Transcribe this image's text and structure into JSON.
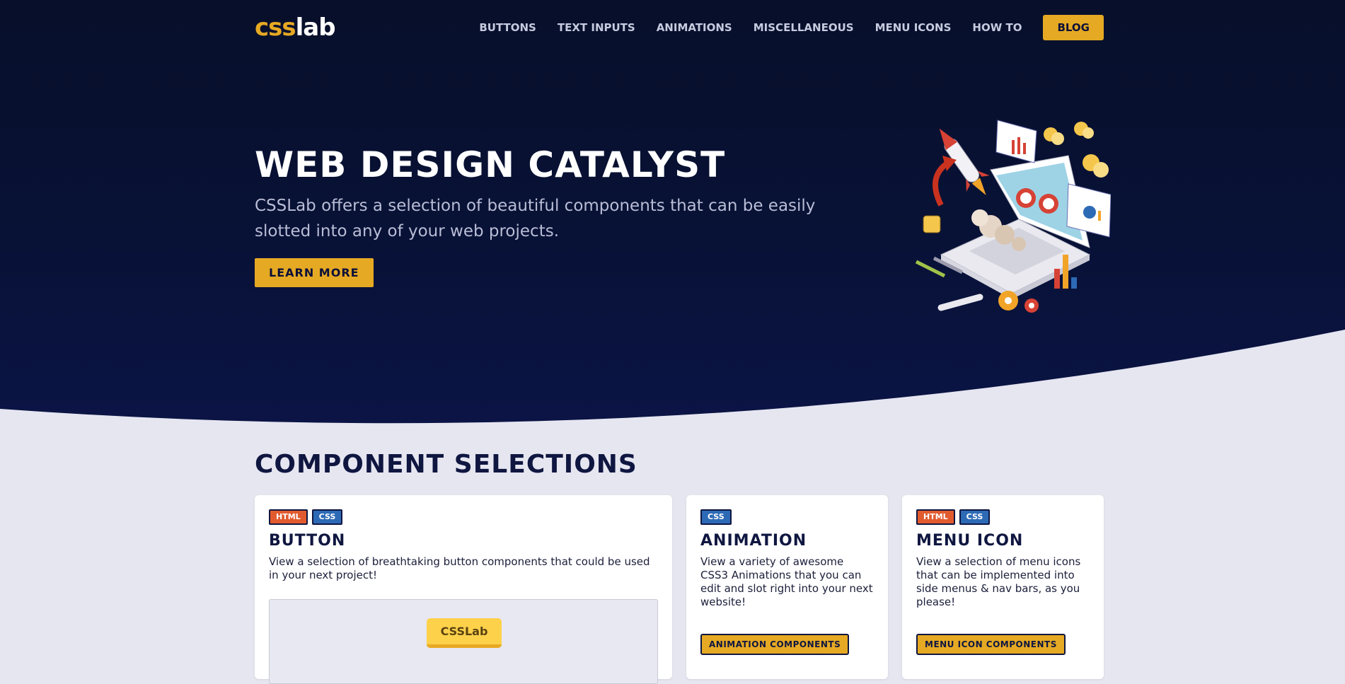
{
  "nav": {
    "logo": {
      "part1": "css",
      "part2": "lab"
    },
    "links": [
      "BUTTONS",
      "TEXT INPUTS",
      "ANIMATIONS",
      "MISCELLANEOUS",
      "MENU ICONS",
      "HOW TO"
    ],
    "blog_label": "BLOG"
  },
  "hero": {
    "title": "WEB DESIGN CATALYST",
    "subtitle": "CSSLab offers a selection of beautiful components that can be easily slotted into any of your web projects.",
    "cta_label": "LEARN MORE"
  },
  "section": {
    "title": "COMPONENT SELECTIONS"
  },
  "cards": [
    {
      "tags": [
        "HTML",
        "CSS"
      ],
      "title": "BUTTON",
      "description": "View a selection of breathtaking button components that could be used in your next project!",
      "demo_button_label": "CSSLab"
    },
    {
      "tags": [
        "CSS"
      ],
      "title": "ANIMATION",
      "description": "View a variety of awesome CSS3 Animations that you can edit and slot right into your next website!",
      "button_label": "ANIMATION COMPONENTS"
    },
    {
      "tags": [
        "HTML",
        "CSS"
      ],
      "title": "MENU ICON",
      "description": "View a selection of menu icons that can be implemented into side menus & nav bars, as you please!",
      "button_label": "MENU ICON COMPONENTS"
    }
  ],
  "colors": {
    "hero_bg": "#081236",
    "accent": "#e6a923",
    "page_bg": "#e6e6f1",
    "tag_html": "#e25b2f",
    "tag_css": "#2d6ab6"
  }
}
